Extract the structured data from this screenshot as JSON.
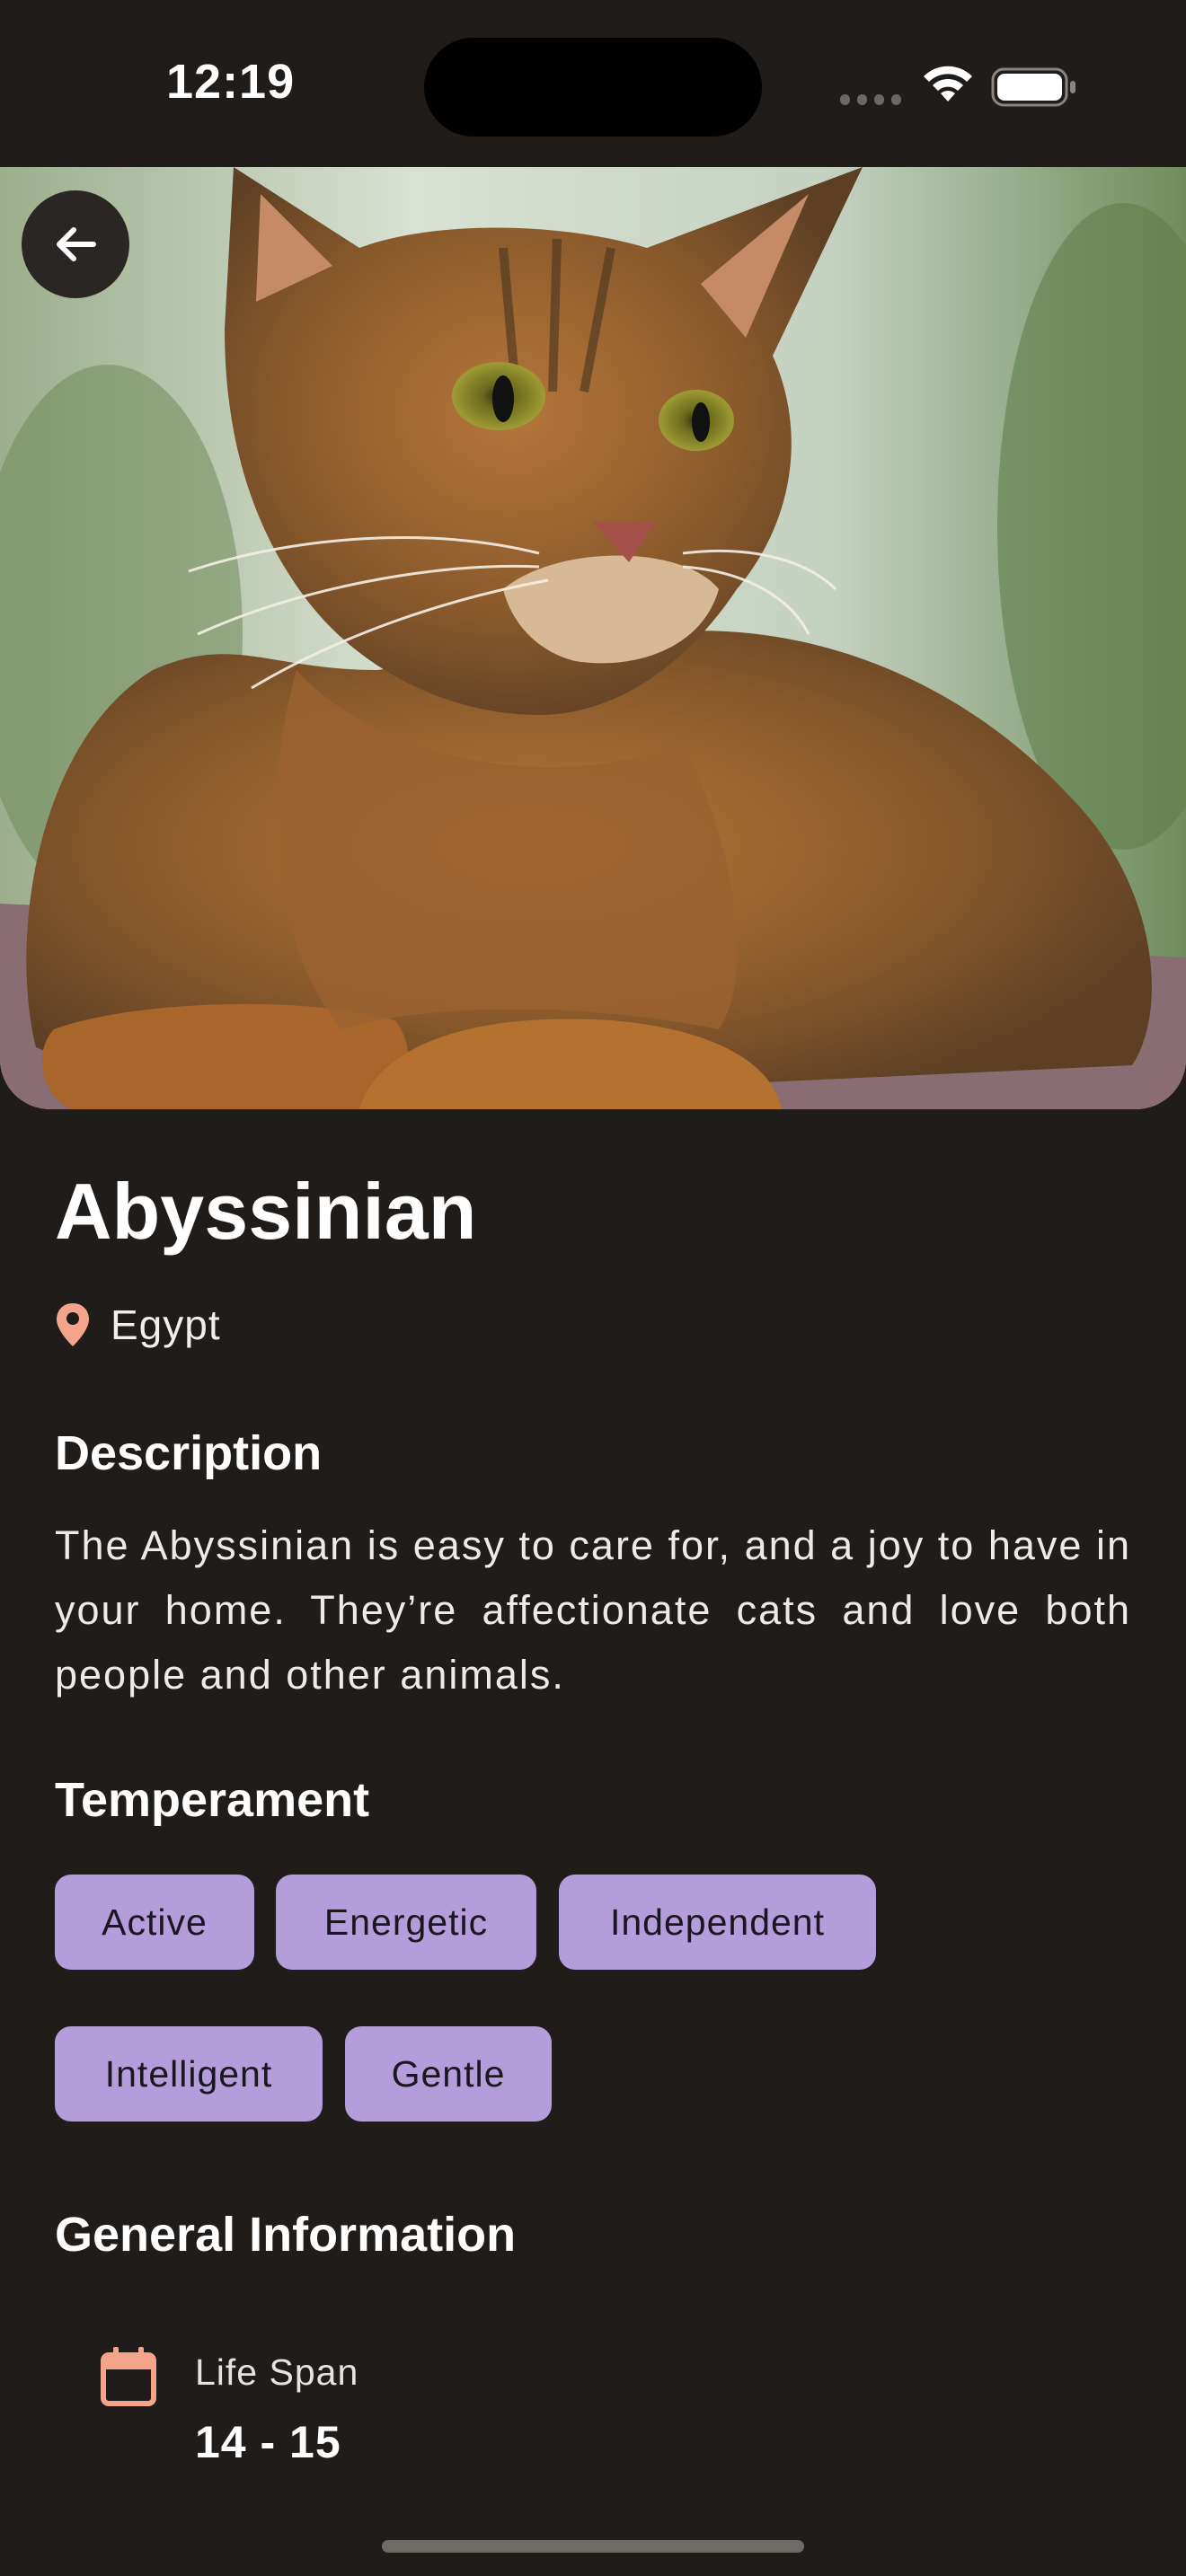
{
  "status_bar": {
    "time": "12:19"
  },
  "header": {
    "back_icon": "arrow-left-icon"
  },
  "breed": {
    "name": "Abyssinian",
    "origin": "Egypt",
    "origin_icon": "location-pin-icon"
  },
  "description": {
    "heading": "Description",
    "text": "The Abyssinian is easy to care for, and a joy to have in your home. They’re affectionate cats and love both people and other animals."
  },
  "temperament": {
    "heading": "Temperament",
    "tags": [
      "Active",
      "Energetic",
      "Independent",
      "Intelligent",
      "Gentle"
    ]
  },
  "general_information": {
    "heading": "General Information",
    "items": [
      {
        "label": "Life Span",
        "value": "14 - 15",
        "icon": "calendar-icon"
      }
    ]
  },
  "colors": {
    "background": "#1f1c19",
    "chip": "#b39ddb",
    "accent": "#f4a48a"
  }
}
